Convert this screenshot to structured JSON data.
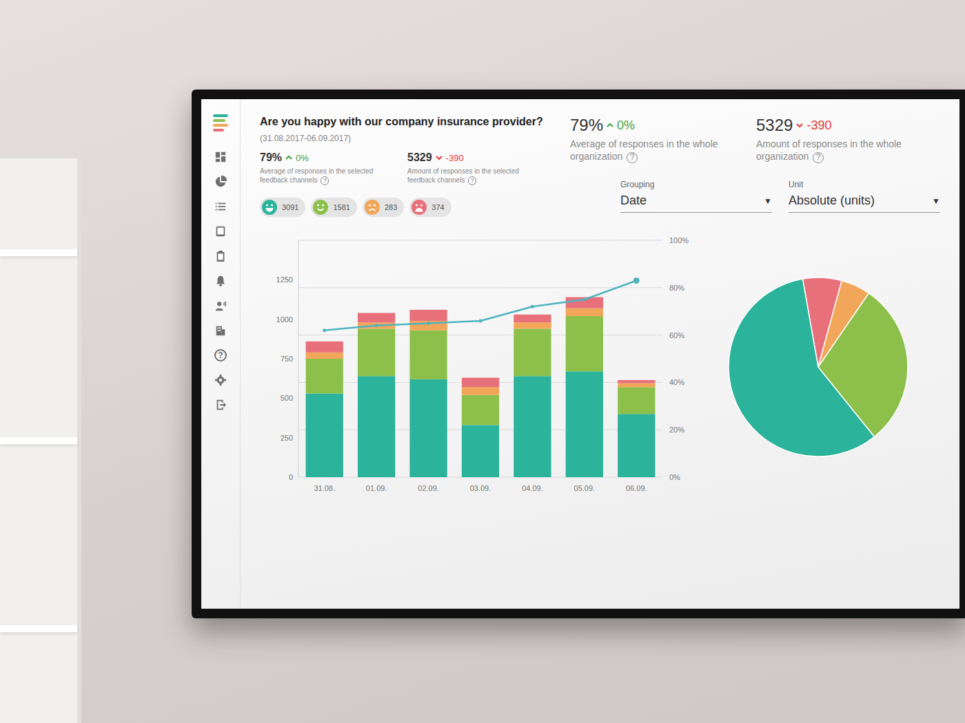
{
  "dashboard": {
    "title": "Are you happy with our company insurance provider?",
    "date_range": "(31.08.2017-06.09.2017)",
    "selected_stats": [
      {
        "value": "79%",
        "change": "0%",
        "trend": "up",
        "label": "Average of responses in the selected feedback channels",
        "help": "?"
      },
      {
        "value": "5329",
        "change": "-390",
        "trend": "down",
        "label": "Amount of responses in the selected feedback channels",
        "help": "?"
      }
    ],
    "organization_stats": [
      {
        "value": "79%",
        "change": "0%",
        "trend": "up",
        "label": "Average of responses in the whole organization",
        "help": "?"
      },
      {
        "value": "5329",
        "change": "-390",
        "trend": "down",
        "label": "Amount of responses in the whole organization",
        "help": "?"
      }
    ],
    "filters": [
      {
        "label": "Grouping",
        "value": "Date",
        "caret": "▼"
      },
      {
        "label": "Unit",
        "value": "Absolute (units)",
        "caret": "▼"
      }
    ],
    "moods": [
      {
        "kind": "very-happy",
        "count": "3091",
        "color": "#2bb39b"
      },
      {
        "kind": "happy",
        "count": "1581",
        "color": "#8cc04b"
      },
      {
        "kind": "sad",
        "count": "283",
        "color": "#f2a65a"
      },
      {
        "kind": "very-sad",
        "count": "374",
        "color": "#e8707a"
      }
    ],
    "chart": {
      "y_ticks": [
        "0",
        "250",
        "500",
        "750",
        "1000",
        "1250"
      ],
      "y2_ticks": [
        "0%",
        "20%",
        "40%",
        "60%",
        "80%",
        "100%"
      ],
      "x_labels": [
        "31.08.",
        "01.09.",
        "02.09.",
        "03.09.",
        "04.09.",
        "05.09.",
        "06.09."
      ],
      "series": [
        {
          "color": "#2bb39b",
          "values": [
            530,
            640,
            620,
            330,
            640,
            670,
            400
          ]
        },
        {
          "color": "#8cc04b",
          "values": [
            220,
            300,
            310,
            190,
            300,
            350,
            170
          ]
        },
        {
          "color": "#f2a65a",
          "values": [
            40,
            40,
            60,
            50,
            40,
            50,
            25
          ]
        },
        {
          "color": "#e8707a",
          "values": [
            70,
            60,
            70,
            60,
            50,
            70,
            20
          ]
        }
      ],
      "line": {
        "values": [
          62,
          64,
          65,
          66,
          72,
          75,
          83
        ]
      }
    },
    "pie": {
      "slices": [
        {
          "value": 374,
          "color": "#e8707a"
        },
        {
          "value": 283,
          "color": "#f2a65a"
        },
        {
          "value": 1581,
          "color": "#8cc04b"
        },
        {
          "value": 3091,
          "color": "#2bb39b"
        }
      ]
    },
    "sidebar": {
      "help": "?"
    }
  }
}
